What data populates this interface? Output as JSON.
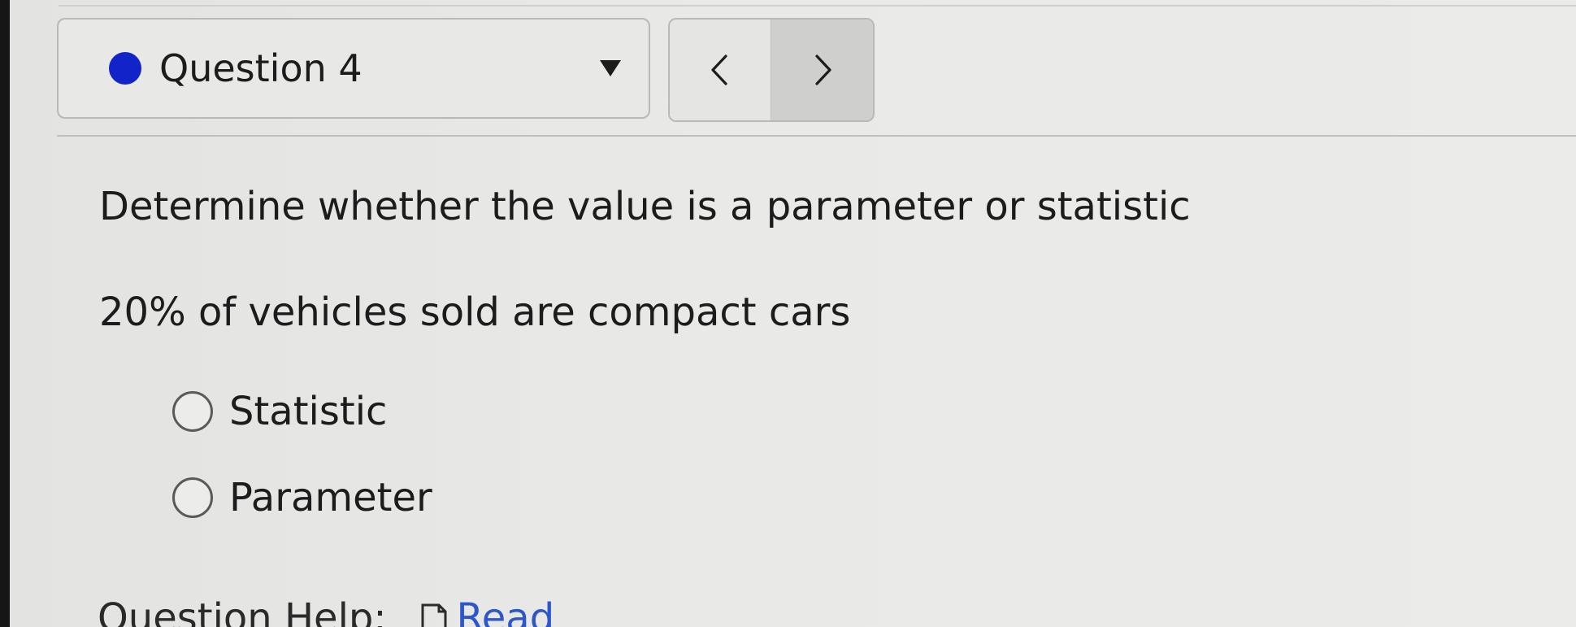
{
  "header": {
    "question_selector": {
      "label": "Question 4",
      "status_color": "#1224c8",
      "icon": "chevron-down-icon"
    },
    "nav": {
      "prev_icon": "chevron-left-icon",
      "next_icon": "chevron-right-icon"
    }
  },
  "question": {
    "prompt": "Determine whether the value is a parameter or statistic",
    "stem": "20% of vehicles sold are compact cars",
    "options": [
      {
        "label": "Statistic",
        "selected": false
      },
      {
        "label": "Parameter",
        "selected": false
      }
    ]
  },
  "help": {
    "label": "Question Help:",
    "link_icon": "document-icon",
    "link_label": "Read"
  },
  "colors": {
    "accent_dot": "#1224c8",
    "link": "#2d56c8"
  }
}
